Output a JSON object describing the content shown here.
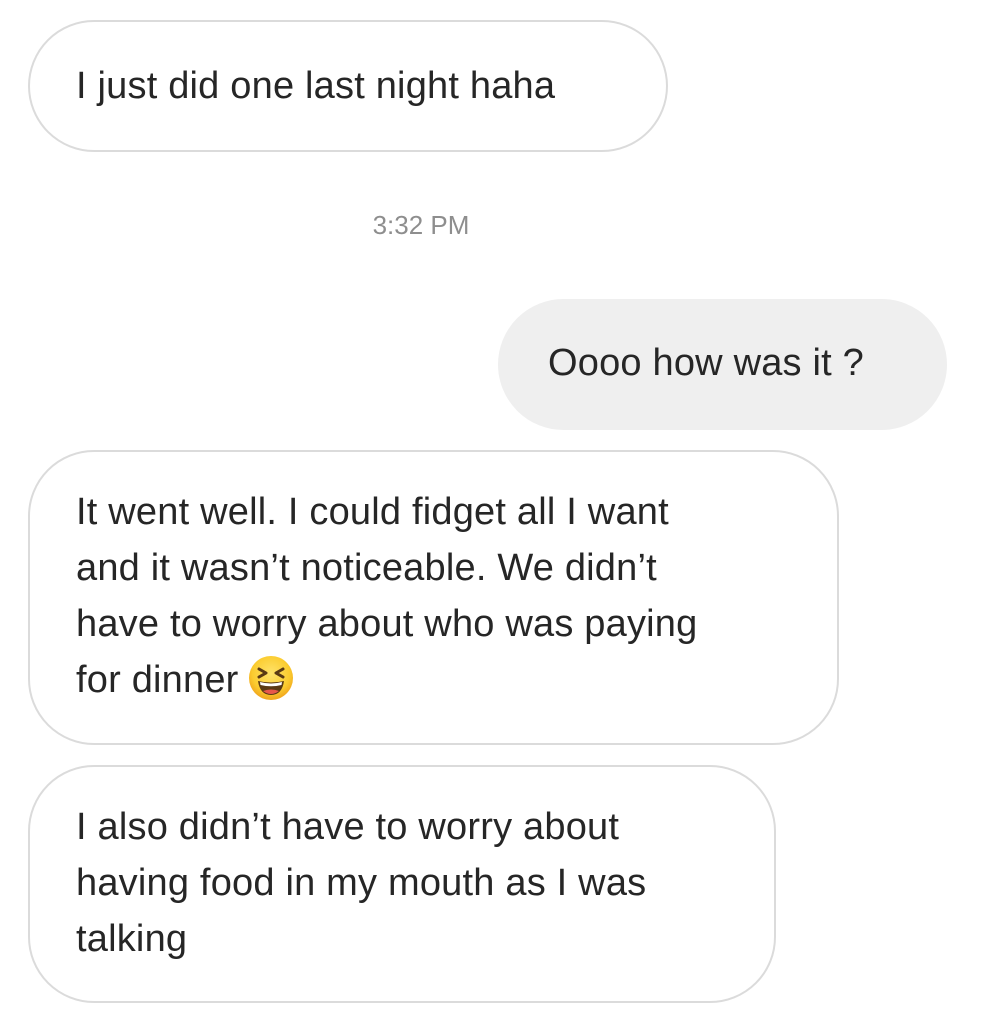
{
  "thread": {
    "messages": [
      {
        "id": "msg1",
        "direction": "incoming",
        "text": "I just did one last night haha"
      },
      {
        "id": "msg2",
        "direction": "outgoing",
        "text": "Oooo how was it ?"
      },
      {
        "id": "msg3",
        "direction": "incoming",
        "lines": [
          "It went well. I could fidget all I want",
          "and it wasn’t noticeable. We didn’t",
          "have to worry about who was paying",
          "for dinner"
        ],
        "emoji": "grinning-squinting-face-icon"
      },
      {
        "id": "msg4",
        "direction": "incoming",
        "lines": [
          "I also didn’t have to worry about",
          "having food in my mouth as I was",
          "talking"
        ]
      }
    ],
    "timestamp": "3:32 PM"
  },
  "colors": {
    "incoming_border": "#dbdbdb",
    "outgoing_fill": "#efefef",
    "timestamp_text": "#8e8e8e",
    "message_text": "#262626"
  }
}
